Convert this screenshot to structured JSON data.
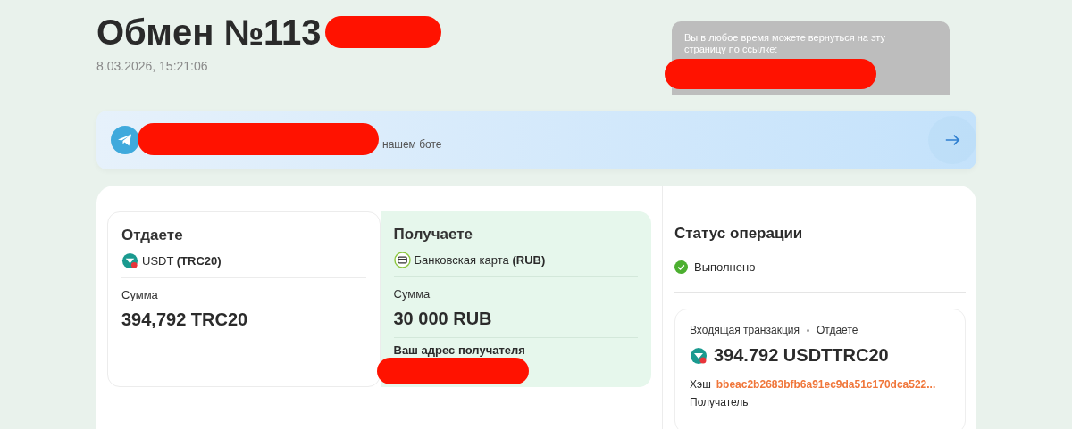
{
  "title": "Обмен №113",
  "date": "8.03.2026, 15:21:06",
  "link_notice": {
    "text": "Вы в любое время можете вернуться на эту страницу по ссылке:"
  },
  "bot_banner": {
    "text": "нашем боте"
  },
  "give": {
    "heading": "Отдаете",
    "currency": "USDT",
    "network": "(TRC20)",
    "amount_label": "Сумма",
    "amount": "394,792 TRC20"
  },
  "receive": {
    "heading": "Получаете",
    "currency": "Банковская карта",
    "network": "(RUB)",
    "amount_label": "Сумма",
    "amount": "30 000 RUB",
    "address_label": "Ваш адрес получателя"
  },
  "status": {
    "heading": "Статус операции",
    "state": "Выполнено",
    "done": true
  },
  "transaction": {
    "type": "Входящая транзакция",
    "side": "Отдаете",
    "amount": "394.792 USDTTRC20",
    "hash_label": "Хэш",
    "hash": "bbeac2b2683bfb6a91ec9da51c170dca522...",
    "recipient_label": "Получатель"
  }
}
